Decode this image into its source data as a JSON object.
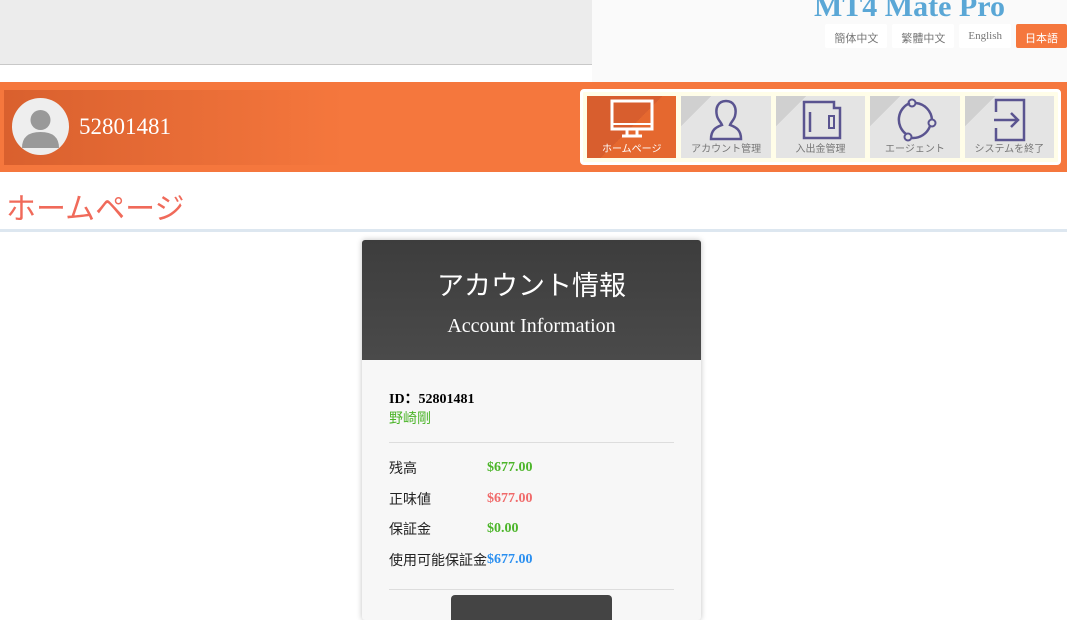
{
  "brand": "MT4 Mate Pro",
  "languages": [
    {
      "label": "簡体中文"
    },
    {
      "label": "繁體中文"
    },
    {
      "label": "English"
    },
    {
      "label": "日本語",
      "active": true
    }
  ],
  "user": {
    "id": "52801481"
  },
  "nav": [
    {
      "label": "ホームページ",
      "icon": "monitor-icon"
    },
    {
      "label": "アカウント管理",
      "icon": "user-icon"
    },
    {
      "label": "入出金管理",
      "icon": "wallet-icon"
    },
    {
      "label": "エージェント",
      "icon": "share-icon"
    },
    {
      "label": "システムを終了",
      "icon": "logout-icon"
    }
  ],
  "page_title": "ホームページ",
  "card": {
    "title_jp": "アカウント情報",
    "title_en": "Account Information",
    "id_label": "ID：52801481",
    "name": "野崎剛",
    "rows": [
      {
        "label": "残高",
        "value": "$677.00",
        "color": "#4cb52a"
      },
      {
        "label": "正味値",
        "value": "$677.00",
        "color": "#f06a6a"
      },
      {
        "label": "保証金",
        "value": "$0.00",
        "color": "#4cb52a"
      },
      {
        "label": "使用可能保証金",
        "value": "$677.00",
        "color": "#2a8ff0"
      }
    ]
  }
}
